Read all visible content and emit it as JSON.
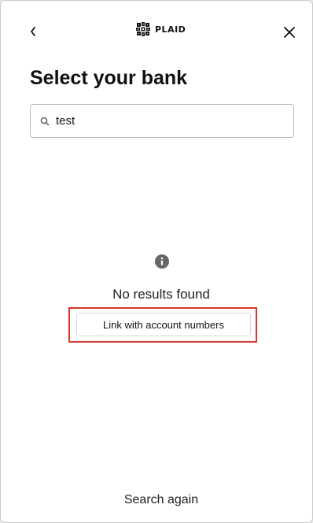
{
  "header": {
    "back_icon": "chevron-left-icon",
    "close_icon": "close-icon",
    "logo_icon": "plaid-logo-icon",
    "logo_text": "PLAID"
  },
  "page": {
    "title": "Select your bank"
  },
  "search": {
    "icon": "search-icon",
    "value": "test"
  },
  "results": {
    "info_icon": "info-icon",
    "empty_message": "No results found",
    "link_button_label": "Link with account numbers",
    "highlight_color": "#d8352c"
  },
  "footer": {
    "search_again_label": "Search again"
  }
}
